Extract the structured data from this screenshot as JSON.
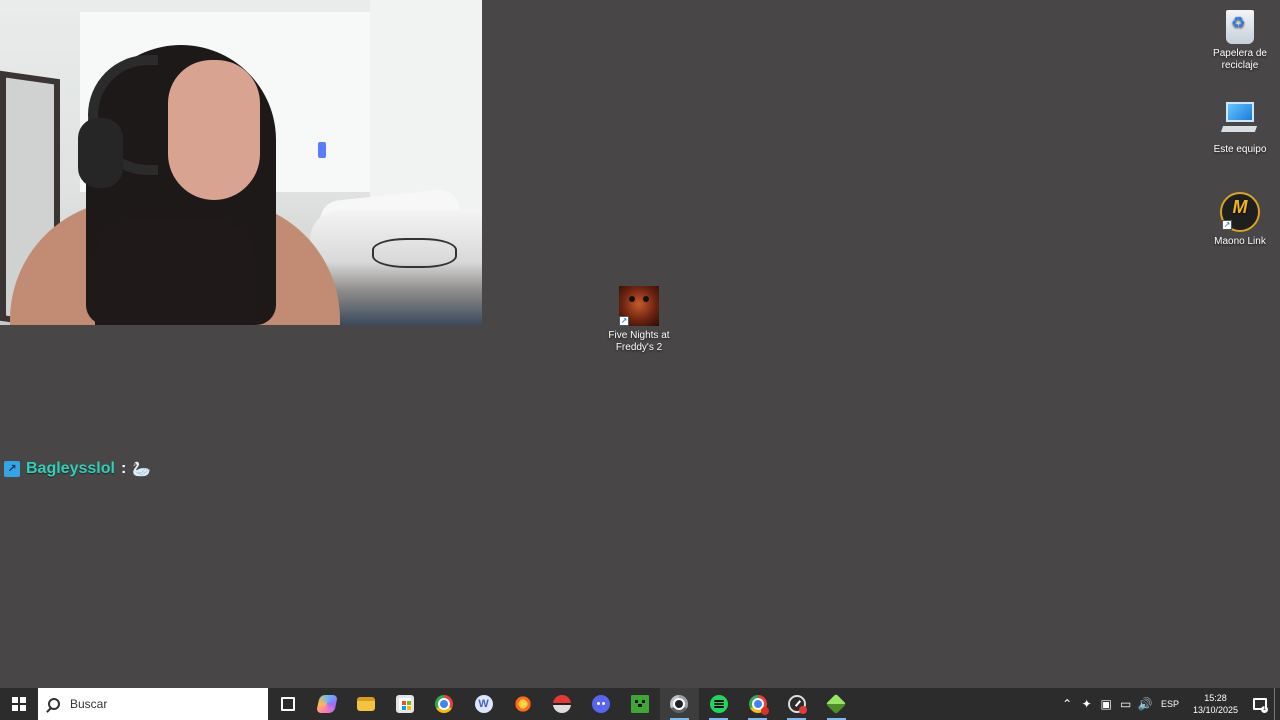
{
  "desktop": {
    "background_color": "#484646",
    "icons": [
      {
        "label": "Papelera de reciclaje",
        "icon": "recycle-bin-icon"
      },
      {
        "label": "Este equipo",
        "icon": "computer-icon"
      },
      {
        "label": "Maono Link",
        "icon": "maono-link-icon",
        "badge": "M"
      },
      {
        "label": "Five Nights at Freddy's 2",
        "icon": "fnaf2-icon"
      }
    ]
  },
  "webcam": {
    "content": "webcam-feed"
  },
  "chat": {
    "username": "Bagleysslol",
    "separator": ":",
    "message": "🦢",
    "username_color": "#2fd0b8"
  },
  "taskbar": {
    "search_placeholder": "Buscar",
    "apps": [
      {
        "name": "task-view",
        "icon": "task-view-icon"
      },
      {
        "name": "copilot",
        "icon": "copilot-icon"
      },
      {
        "name": "file-explorer",
        "icon": "folder-icon"
      },
      {
        "name": "microsoft-store",
        "icon": "store-icon"
      },
      {
        "name": "chrome",
        "icon": "chrome-icon"
      },
      {
        "name": "w-app",
        "icon": "w-app-icon",
        "letter": "W"
      },
      {
        "name": "burst-app",
        "icon": "burst-icon"
      },
      {
        "name": "pokeball-app",
        "icon": "pokeball-icon"
      },
      {
        "name": "discord",
        "icon": "discord-icon"
      },
      {
        "name": "minecraft",
        "icon": "minecraft-icon"
      },
      {
        "name": "chrome-profile",
        "icon": "chrome-profile-icon"
      },
      {
        "name": "spotify",
        "icon": "spotify-icon"
      },
      {
        "name": "chrome-red",
        "icon": "chrome-red-icon"
      },
      {
        "name": "speedometer-app",
        "icon": "speedometer-icon"
      },
      {
        "name": "cube-app",
        "icon": "cube-icon"
      }
    ],
    "tray": {
      "language": "ESP",
      "time": "15:28",
      "date": "13/10/2025",
      "notification_count": "1"
    }
  }
}
